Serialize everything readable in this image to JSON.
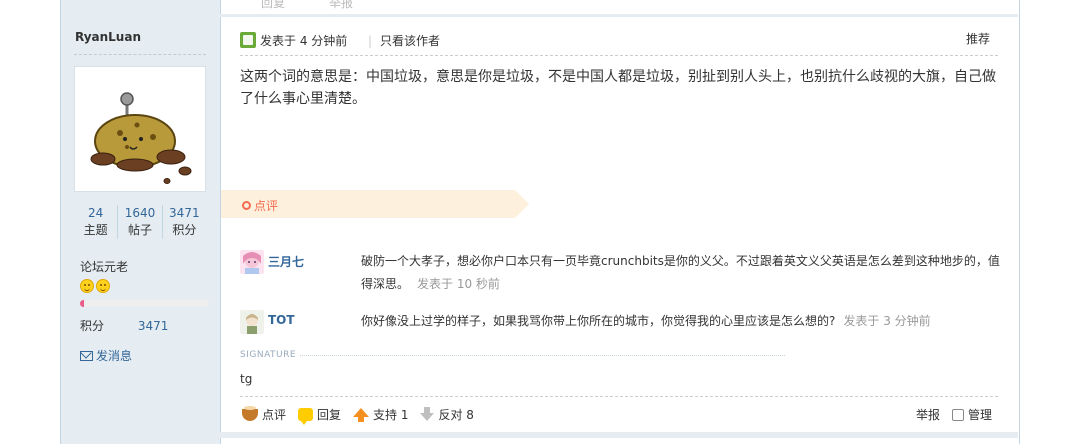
{
  "top_strip": {
    "faint_left": "回复",
    "faint_right": "举报"
  },
  "author": {
    "name": "RyanLuan",
    "stats": [
      {
        "value": "24",
        "label": "主题"
      },
      {
        "value": "1640",
        "label": "帖子"
      },
      {
        "value": "3471",
        "label": "积分"
      }
    ],
    "rank_title": "论坛元老",
    "rank_progress": 0.03,
    "points_label": "积分",
    "points_value": "3471",
    "message_link": "发消息"
  },
  "post": {
    "time": "发表于 4 分钟前",
    "author_only": "只看该作者",
    "recommend": "推荐",
    "content": "这两个词的意思是：中国垃圾，意思是你是垃圾，不是中国人都是垃圾，别扯到别人头上，也别抗什么歧视的大旗，自己做了什么事心里清楚。"
  },
  "comments": {
    "title": "点评",
    "items": [
      {
        "user": "三月七",
        "text": "破防一个大孝子，想必你户口本只有一页毕竟crunchbits是你的义父。不过跟着英文义父英语是怎么差到这种地步的，值得深思。",
        "time": "发表于 10 秒前"
      },
      {
        "user": "TOT",
        "text": "你好像没上过学的样子，如果我骂你带上你所在的城市，你觉得我的心里应该是怎么想的?",
        "time": "发表于 3 分钟前"
      }
    ]
  },
  "signature": {
    "label": "SIGNATURE",
    "text": "tg"
  },
  "actions": {
    "rate": "点评",
    "reply": "回复",
    "support": "支持 1",
    "oppose": "反对 8",
    "report": "举报",
    "manage": "管理"
  },
  "colors": {
    "link": "#336699",
    "sidebar_bg": "#e5edf2",
    "accent": "#f26c4f"
  }
}
